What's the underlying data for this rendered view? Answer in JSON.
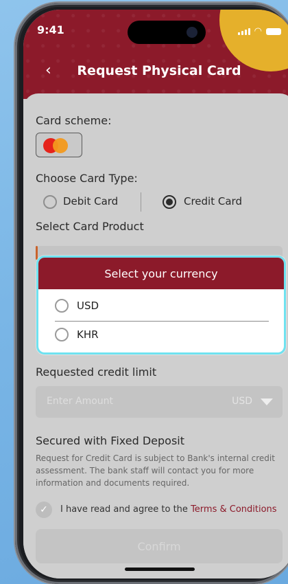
{
  "status_bar": {
    "time": "9:41"
  },
  "header": {
    "title": "Request Physical Card",
    "back_glyph": "‹"
  },
  "card_scheme": {
    "label": "Card scheme:"
  },
  "card_type": {
    "label": "Choose Card Type:",
    "options": [
      {
        "label": "Debit Card",
        "selected": false
      },
      {
        "label": "Credit Card",
        "selected": true
      }
    ]
  },
  "card_product": {
    "label": "Select Card Product"
  },
  "currency_modal": {
    "title": "Select your currency",
    "options": [
      {
        "label": "USD",
        "selected": false
      },
      {
        "label": "KHR",
        "selected": false
      }
    ]
  },
  "credit_limit": {
    "label": "Requested credit limit",
    "placeholder": "Enter Amount",
    "currency": "USD"
  },
  "fixed_deposit": {
    "title": "Secured with Fixed Deposit",
    "text": "Request for Credit Card is subject to Bank's internal credit assessment. The bank staff will contact you for more information and documents required."
  },
  "agreement": {
    "prefix": "I have read and agree to the ",
    "link": "Terms & Conditions",
    "check_glyph": "✓"
  },
  "confirm_button": {
    "label": "Confirm"
  },
  "colors": {
    "brand_red": "#8c1a2a",
    "accent_yellow": "#e5b02b",
    "modal_outline": "#6fe2f0",
    "background_blue": "#7ab6e6"
  }
}
